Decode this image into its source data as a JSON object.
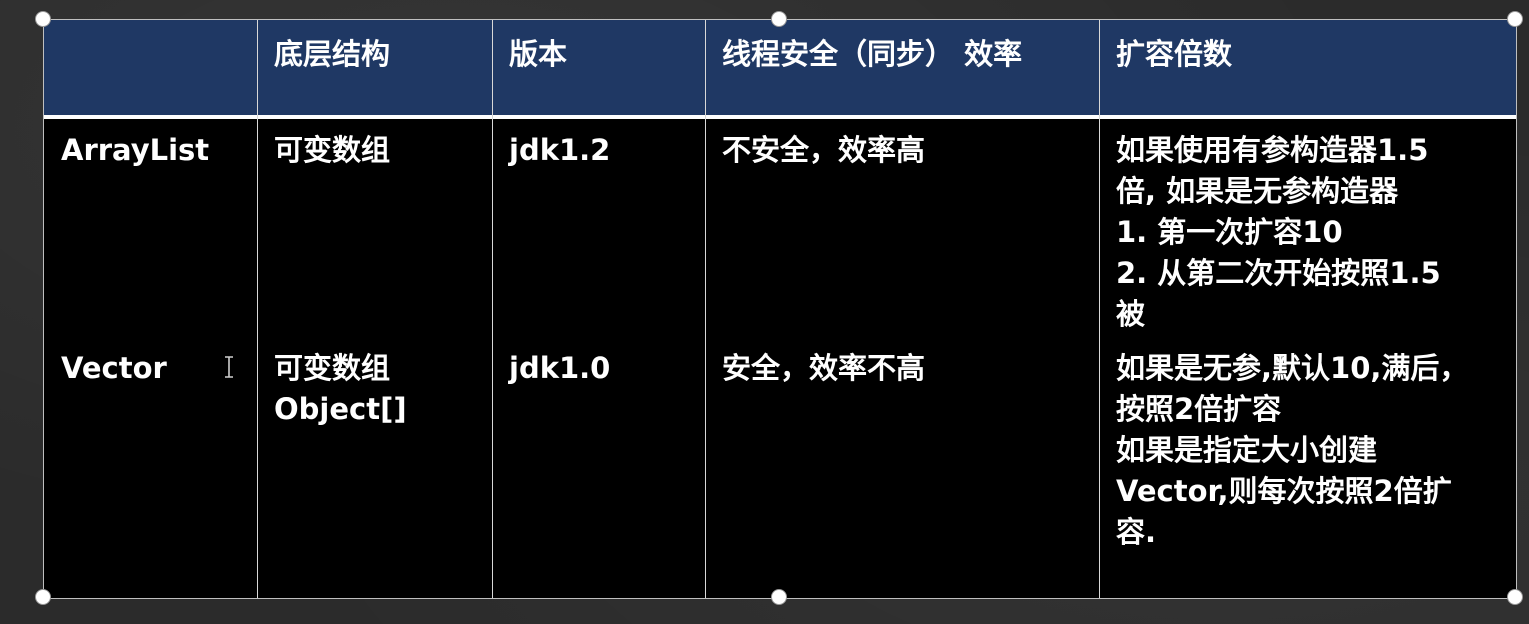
{
  "table": {
    "headers": [
      "",
      "底层结构",
      "版本",
      "线程安全（同步） 效率",
      "扩容倍数"
    ],
    "rows": [
      {
        "name": "ArrayList",
        "structure": "可变数组",
        "version": "jdk1.2",
        "thread_safety": "不安全，效率高",
        "growth": "如果使用有参构造器1.5\n倍, 如果是无参构造器\n1. 第一次扩容10\n2. 从第二次开始按照1.5\n被"
      },
      {
        "name": "Vector",
        "structure": "可变数组\nObject[]",
        "version": "jdk1.0",
        "thread_safety": "安全，效率不高",
        "growth": "如果是无参,默认10,满后，\n按照2倍扩容\n如果是指定大小创建\nVector,则每次按照2倍扩\n容."
      }
    ]
  },
  "colors": {
    "header_bg": "#1f3864",
    "body_bg": "#000000",
    "text": "#ffffff",
    "slide_bg": "#2b2b2b"
  },
  "icons": {
    "cursor": "text-cursor-icon",
    "handles": "resize-handle-icon"
  }
}
